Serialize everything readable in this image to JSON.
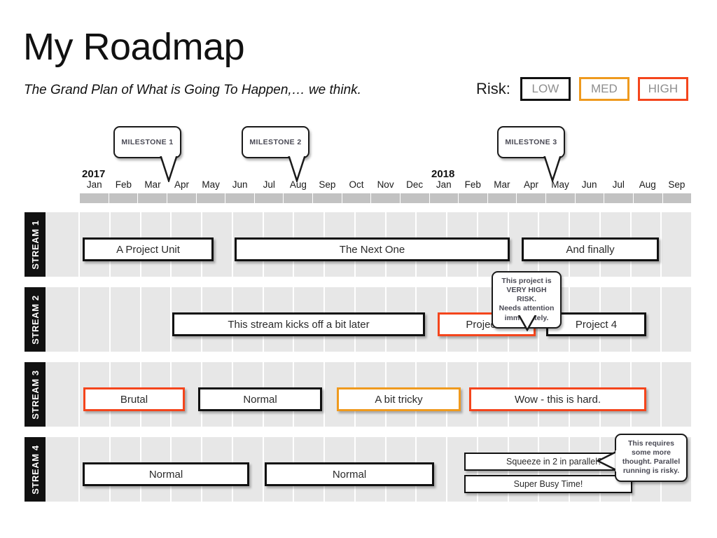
{
  "header": {
    "title": "My Roadmap",
    "subtitle": "The Grand Plan of What is Going To Happen,… we think."
  },
  "risk_legend": {
    "label": "Risk:",
    "items": [
      {
        "level": "LOW",
        "color": "#111111"
      },
      {
        "level": "MED",
        "color": "#ef9a1e"
      },
      {
        "level": "HIGH",
        "color": "#f4451c"
      }
    ]
  },
  "timeline": {
    "years": [
      {
        "label": "2017",
        "start_month_index": 0
      },
      {
        "label": "2018",
        "start_month_index": 12
      }
    ],
    "months": [
      "Jan",
      "Feb",
      "Mar",
      "Apr",
      "May",
      "Jun",
      "Jul",
      "Aug",
      "Sep",
      "Oct",
      "Nov",
      "Dec",
      "Jan",
      "Feb",
      "Mar",
      "Apr",
      "May",
      "Jun",
      "Jul",
      "Aug",
      "Sep"
    ]
  },
  "milestones": [
    {
      "label": "MILESTONE 1",
      "points_to": "Apr 2017"
    },
    {
      "label": "MILESTONE 2",
      "points_to": "Aug 2017"
    },
    {
      "label": "MILESTONE 3",
      "points_to": "May 2018"
    }
  ],
  "streams": [
    {
      "label": "STREAM 1",
      "bars": [
        {
          "text": "A Project Unit",
          "risk": "LOW"
        },
        {
          "text": "The Next One",
          "risk": "LOW"
        },
        {
          "text": "And finally",
          "risk": "LOW"
        }
      ]
    },
    {
      "label": "STREAM 2",
      "bars": [
        {
          "text": "This stream kicks off a bit later",
          "risk": "LOW"
        },
        {
          "text": "Project 3",
          "risk": "HIGH"
        },
        {
          "text": "Project 4",
          "risk": "LOW"
        }
      ]
    },
    {
      "label": "STREAM 3",
      "bars": [
        {
          "text": "Brutal",
          "risk": "HIGH"
        },
        {
          "text": "Normal",
          "risk": "LOW"
        },
        {
          "text": "A bit tricky",
          "risk": "MED"
        },
        {
          "text": "Wow - this is hard.",
          "risk": "HIGH"
        }
      ]
    },
    {
      "label": "STREAM 4",
      "bars": [
        {
          "text": "Normal",
          "risk": "LOW"
        },
        {
          "text": "Normal",
          "risk": "LOW"
        },
        {
          "text": "Squeeze in 2 in parallel?",
          "risk": "LOW"
        },
        {
          "text": "Super Busy Time!",
          "risk": "LOW"
        }
      ]
    }
  ],
  "notes": [
    {
      "id": "note-project-3",
      "text": "This project is VERY HIGH RISK. Needs attention immediately.",
      "lines": [
        "This project is",
        "VERY HIGH RISK.",
        "Needs attention",
        "immediately."
      ],
      "attached_to": "Project 3"
    },
    {
      "id": "note-parallel",
      "text": "This requires some more thought. Parallel running is risky.",
      "lines": [
        "This requires",
        "some more",
        "thought. Parallel",
        "running is risky."
      ],
      "attached_to": "Squeeze in 2 in parallel?"
    }
  ]
}
